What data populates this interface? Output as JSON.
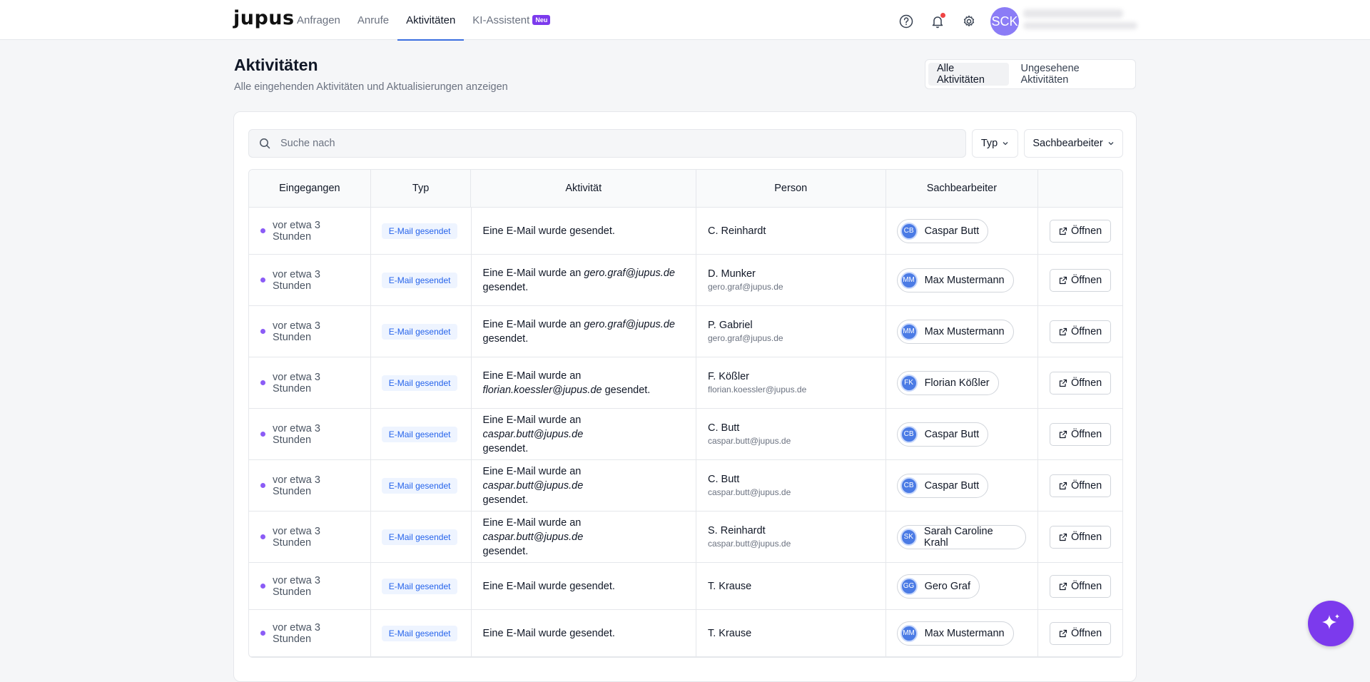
{
  "brand": "jupus",
  "nav": [
    {
      "label": "Anfragen"
    },
    {
      "label": "Anrufe"
    },
    {
      "label": "Aktivitäten",
      "active": true
    },
    {
      "label": "KI-Assistent",
      "badge": "Neu"
    }
  ],
  "user": {
    "initials": "SCK"
  },
  "page": {
    "title": "Aktivitäten",
    "subtitle": "Alle eingehenden Aktivitäten und Aktualisierungen anzeigen"
  },
  "view_toggle": {
    "all": "Alle Aktivitäten",
    "unseen": "Ungesehene Aktivitäten"
  },
  "search": {
    "placeholder": "Suche nach"
  },
  "filters": {
    "type": "Typ",
    "agent": "Sachbearbeiter"
  },
  "table": {
    "headers": [
      "Eingegangen",
      "Typ",
      "Aktivität",
      "Person",
      "Sachbearbeiter",
      ""
    ],
    "rows": [
      {
        "time": "vor etwa 3 Stunden",
        "type": "E-Mail gesendet",
        "act_pre": "Eine E-Mail wurde gesendet.",
        "act_em": "",
        "act_post": "",
        "person": "C. Reinhardt",
        "email": "",
        "agent_initials": "CB",
        "agent": "Caspar Butt",
        "open": "Öffnen"
      },
      {
        "time": "vor etwa 3 Stunden",
        "type": "E-Mail gesendet",
        "act_pre": "Eine E-Mail wurde an ",
        "act_em": "gero.graf@jupus.de",
        "act_post": "gesendet.",
        "person": "D. Munker",
        "email": "gero.graf@jupus.de",
        "agent_initials": "MM",
        "agent": "Max Mustermann",
        "open": "Öffnen"
      },
      {
        "time": "vor etwa 3 Stunden",
        "type": "E-Mail gesendet",
        "act_pre": "Eine E-Mail wurde an ",
        "act_em": "gero.graf@jupus.de",
        "act_post": "gesendet.",
        "person": "P. Gabriel",
        "email": "gero.graf@jupus.de",
        "agent_initials": "MM",
        "agent": "Max Mustermann",
        "open": "Öffnen"
      },
      {
        "time": "vor etwa 3 Stunden",
        "type": "E-Mail gesendet",
        "act_pre": "Eine E-Mail wurde an",
        "act_em": "florian.koessler@jupus.de",
        "act_post": " gesendet.",
        "person": "F. Kößler",
        "email": "florian.koessler@jupus.de",
        "agent_initials": "FK",
        "agent": "Florian Kößler",
        "open": "Öffnen"
      },
      {
        "time": "vor etwa 3 Stunden",
        "type": "E-Mail gesendet",
        "act_pre": "Eine E-Mail wurde an ",
        "act_em": "caspar.butt@jupus.de",
        "act_post": "gesendet.",
        "person": "C. Butt",
        "email": "caspar.butt@jupus.de",
        "agent_initials": "CB",
        "agent": "Caspar Butt",
        "open": "Öffnen"
      },
      {
        "time": "vor etwa 3 Stunden",
        "type": "E-Mail gesendet",
        "act_pre": "Eine E-Mail wurde an ",
        "act_em": "caspar.butt@jupus.de",
        "act_post": "gesendet.",
        "person": "C. Butt",
        "email": "caspar.butt@jupus.de",
        "agent_initials": "CB",
        "agent": "Caspar Butt",
        "open": "Öffnen"
      },
      {
        "time": "vor etwa 3 Stunden",
        "type": "E-Mail gesendet",
        "act_pre": "Eine E-Mail wurde an ",
        "act_em": "caspar.butt@jupus.de",
        "act_post": "gesendet.",
        "person": "S. Reinhardt",
        "email": "caspar.butt@jupus.de",
        "agent_initials": "SK",
        "agent": "Sarah Caroline Krahl",
        "open": "Öffnen"
      },
      {
        "time": "vor etwa 3 Stunden",
        "type": "E-Mail gesendet",
        "act_pre": "Eine E-Mail wurde gesendet.",
        "act_em": "",
        "act_post": "",
        "person": "T. Krause",
        "email": "",
        "agent_initials": "GG",
        "agent": "Gero Graf",
        "open": "Öffnen"
      },
      {
        "time": "vor etwa 3 Stunden",
        "type": "E-Mail gesendet",
        "act_pre": "Eine E-Mail wurde gesendet.",
        "act_em": "",
        "act_post": "",
        "person": "T. Krause",
        "email": "",
        "agent_initials": "MM",
        "agent": "Max Mustermann",
        "open": "Öffnen"
      }
    ]
  },
  "colors": {
    "accent": "#3b6fe0",
    "brand_purple": "#7c3aed",
    "dot": "#8b5cf6",
    "badge_bg": "#eef4ff",
    "badge_text": "#2563eb"
  }
}
